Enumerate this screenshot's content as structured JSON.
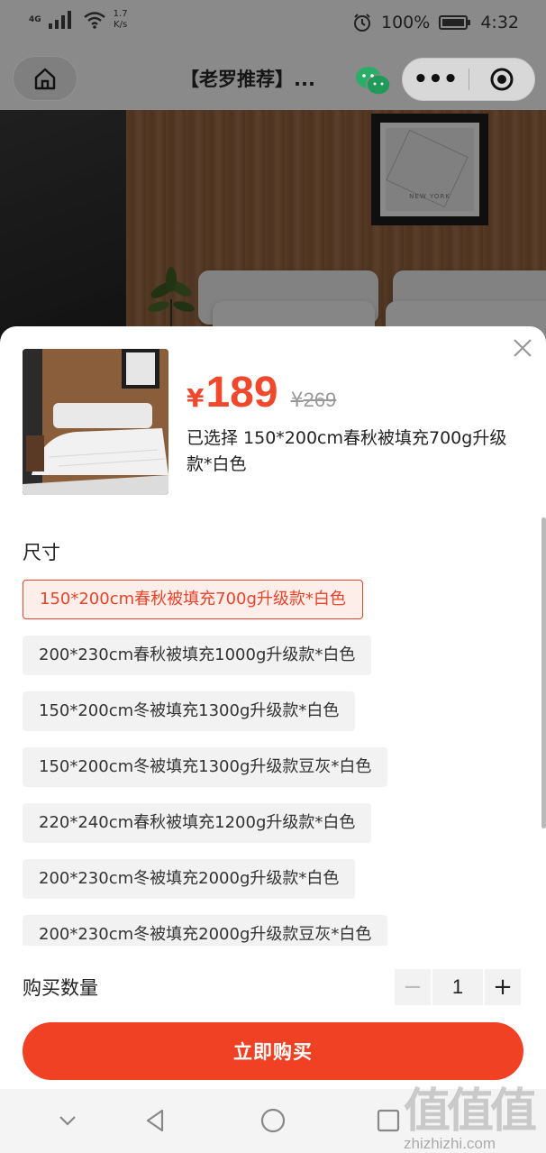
{
  "status_bar": {
    "network_type": "4G",
    "speed_value": "1.7",
    "speed_unit": "K/s",
    "battery": "100%",
    "time": "4:32"
  },
  "nav": {
    "title": "【老罗推荐】...",
    "more_glyph": "•••"
  },
  "hero": {
    "frame_caption": "NEW YORK"
  },
  "sheet": {
    "price_symbol": "¥",
    "price": "189",
    "original_symbol": "¥",
    "original_price": "269",
    "selected_label": "已选择",
    "selected_value": "150*200cm春秋被填充700g升级款*白色",
    "size_title": "尺寸",
    "options": [
      {
        "label": "150*200cm春秋被填充700g升级款*白色",
        "selected": true
      },
      {
        "label": "200*230cm春秋被填充1000g升级款*白色",
        "selected": false
      },
      {
        "label": "150*200cm冬被填充1300g升级款*白色",
        "selected": false
      },
      {
        "label": "150*200cm冬被填充1300g升级款豆灰*白色",
        "selected": false
      },
      {
        "label": "220*240cm春秋被填充1200g升级款*白色",
        "selected": false
      },
      {
        "label": "200*230cm冬被填充2000g升级款*白色",
        "selected": false
      },
      {
        "label": "200*230cm冬被填充2000g升级款豆灰*白色",
        "selected": false
      }
    ],
    "qty_label": "购买数量",
    "qty_minus": "−",
    "qty_value": "1",
    "qty_plus": "+",
    "buy_label": "立即购买"
  },
  "watermark": {
    "glyphs": "值值值",
    "site": "zhizhizhi.com"
  },
  "colors": {
    "accent": "#f04124",
    "price": "#f0482c"
  }
}
